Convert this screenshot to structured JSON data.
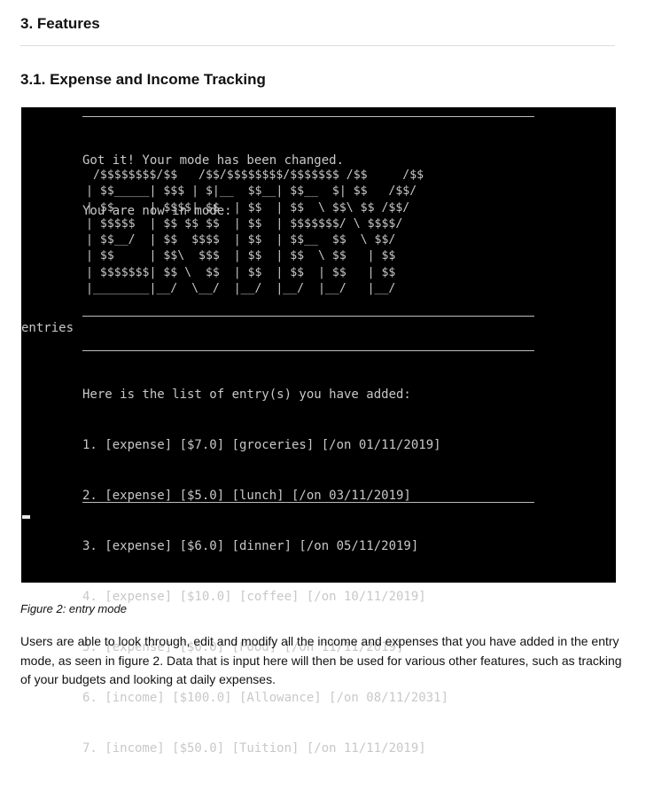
{
  "section_heading": "3. Features",
  "subsection_heading": "3.1. Expense and Income Tracking",
  "terminal": {
    "message_lines": [
      "Got it! Your mode has been changed.",
      "You are now in mode:"
    ],
    "banner": " /$$$$$$$$/$$   /$$/$$$$$$$$/$$$$$$$ /$$     /$$\n| $$_____| $$$ | $|__  $$__| $$__  $| $$   /$$/\n| $$     | $$$$| $$  | $$  | $$  \\ $$\\ $$ /$$/\n| $$$$$  | $$ $$ $$  | $$  | $$$$$$$/ \\ $$$$/\n| $$__/  | $$  $$$$  | $$  | $$__  $$  \\ $$/\n| $$     | $$\\  $$$  | $$  | $$  \\ $$   | $$\n| $$$$$$$| $$ \\  $$  | $$  | $$  | $$   | $$\n|________|__/  \\__/  |__/  |__/  |__/   |__/",
    "mode_name": "entries",
    "list_header": "Here is the list of entry(s) you have added:",
    "entries": [
      "1. [expense] [$7.0] [groceries] [/on 01/11/2019]",
      "2. [expense] [$5.0] [lunch] [/on 03/11/2019]",
      "3. [expense] [$6.0] [dinner] [/on 05/11/2019]",
      "4. [expense] [$10.0] [coffee] [/on 10/11/2019]",
      "5. [expense] [$6.0] [Food] [/on 11/11/2019]",
      "6. [income] [$100.0] [Allowance] [/on 08/11/2031]",
      "7. [income] [$50.0] [Tuition] [/on 11/11/2019]"
    ]
  },
  "figure_caption": "Figure 2: entry mode",
  "paragraph": "Users are able to look through, edit and modify all the income and expenses that you have added in the entry mode, as seen in figure 2. Data that is input here will then be used for various other features, such as tracking of your budgets and looking at daily expenses."
}
